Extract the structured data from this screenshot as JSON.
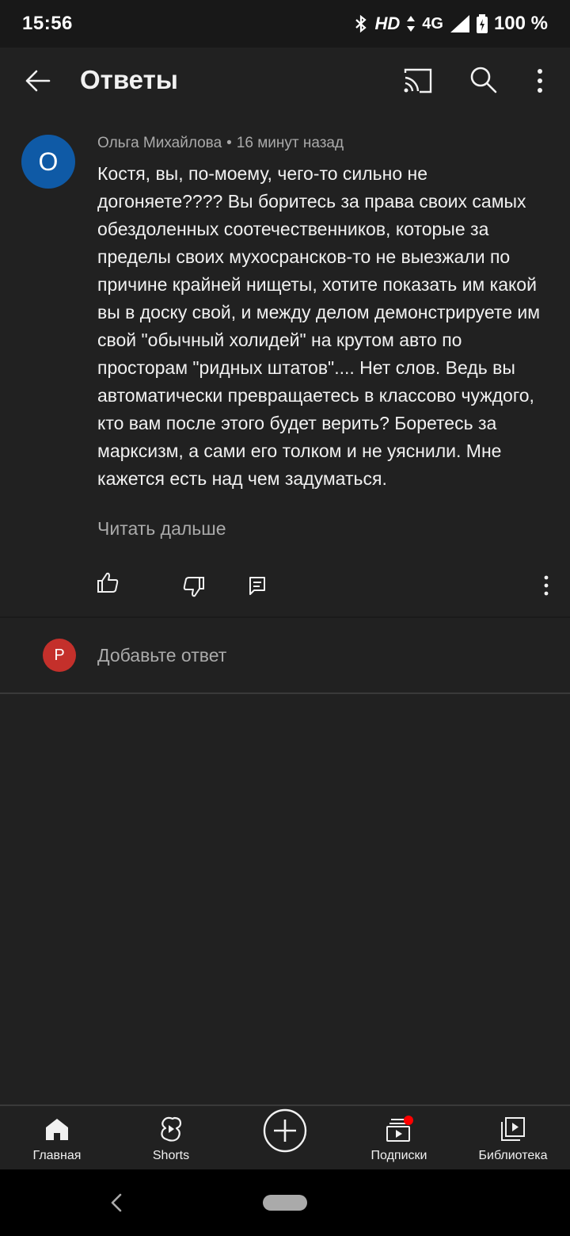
{
  "status_bar": {
    "time": "15:56",
    "hd": "HD",
    "network": "4G",
    "battery": "100 %"
  },
  "app_bar": {
    "title": "Ответы"
  },
  "comment": {
    "avatar_letter": "О",
    "avatar_color": "#0f5aa6",
    "author": "Ольга Михайлова",
    "separator": "•",
    "time": "16 минут назад",
    "text": "Костя, вы, по-моему, чего-то сильно не догоняете???? Вы боритесь за права своих самых обездоленных соотечественников, которые за пределы своих мухосрансков-то не выезжали по причине крайней нищеты, хотите показать им какой вы в доску свой, и между делом демонстрируете им свой \"обычный холидей\" на крутом авто по просторам \"ридных штатов\".... Нет слов. Ведь вы автоматически превращаетесь в классово чуждого, кто вам после этого будет верить? Боретесь за марксизм, а сами его толком и не уяснили. Мне кажется есть над чем задуматься.",
    "read_more": "Читать дальше"
  },
  "reply": {
    "avatar_letter": "Р",
    "avatar_color": "#c4302b",
    "placeholder": "Добавьте ответ"
  },
  "bottom_nav": {
    "items": [
      {
        "label": "Главная",
        "icon": "home-icon"
      },
      {
        "label": "Shorts",
        "icon": "shorts-icon"
      },
      {
        "label": "",
        "icon": "create-icon"
      },
      {
        "label": "Подписки",
        "icon": "subscriptions-icon"
      },
      {
        "label": "Библиотека",
        "icon": "library-icon"
      }
    ],
    "notification_color": "#ff0000"
  }
}
